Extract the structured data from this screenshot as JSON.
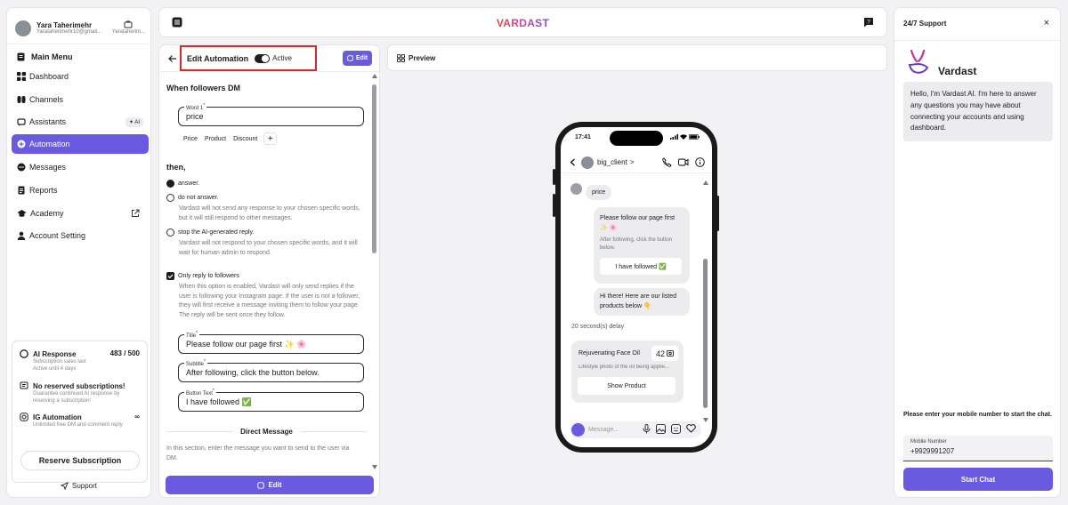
{
  "user": {
    "name": "Yara Taherimehr",
    "email": "Yarataherimehr10@gmail...",
    "short": "Yarataherim..."
  },
  "sidebar": {
    "menu_title": "Main Menu",
    "items": [
      {
        "label": "Dashboard"
      },
      {
        "label": "Channels"
      },
      {
        "label": "Assistants",
        "badge": "AI"
      },
      {
        "label": "Automation"
      },
      {
        "label": "Messages"
      },
      {
        "label": "Reports"
      },
      {
        "label": "Academy"
      },
      {
        "label": "Account Setting"
      }
    ]
  },
  "subscription": {
    "ai_response": {
      "title": "AI Response",
      "count": "483 / 500",
      "desc": "Subscription sales last\nActive until 4 days"
    },
    "reserved": {
      "title": "No reserved subscriptions!",
      "desc": "Guarantee continued AI response by reserving a subscription!"
    },
    "ig": {
      "title": "IG Automation",
      "desc": "Unlimited free DM and comment reply"
    },
    "reserve_button": "Reserve Subscription"
  },
  "support_link": "Support",
  "brand": "VARDAST",
  "editor": {
    "title": "Edit Automation",
    "active_label": "Active",
    "edit_small": "Edit",
    "when_label": "When followers DM",
    "word_label": "Word 1",
    "word_value": "price",
    "chips": [
      "Price",
      "Product",
      "Discount"
    ],
    "chip_add": "+",
    "then_label": "then,",
    "options": [
      {
        "label": "answer."
      },
      {
        "label": "do not answer.",
        "desc": "Vardast will not send any response to your chosen specific words, but it will still respond to other messages."
      },
      {
        "label": "stop the AI-generated reply.",
        "desc": "Vardast will not respond to your chosen specific words, and it will wait for human admin to respond."
      }
    ],
    "followers_only": {
      "label": "Only reply to followers",
      "desc": "When this option is enabled, Vardast will only send replies if the user is following your Instagram page. If the user is not a follower, they will first receive a message inviting them to follow your page. The reply will be sent once they follow."
    },
    "title_field": {
      "label": "Title",
      "value": "Please follow our page first ✨ 🌸"
    },
    "subtitle_field": {
      "label": "Subtitle",
      "value": "After following, click the button below."
    },
    "button_field": {
      "label": "Button Text",
      "value": "I have followed ✅"
    },
    "direct_message": "Direct Message",
    "dm_desc": "In this section, enter the message you want to send to the user via DM.",
    "edit_big": "Edit"
  },
  "preview": {
    "label": "Preview",
    "time": "17:41",
    "username": "big_client",
    "chevron": ">",
    "user_msg": "price",
    "card1": {
      "title": "Please follow our page first ✨ 🌸",
      "subtitle": "After following, click the button below.",
      "button": "I have followed ✅"
    },
    "msg2": "Hi there! Here are our listed products below 👇",
    "delay": "20 second(s) delay",
    "product": {
      "name": "Rejuvenating Face Oil",
      "count": "42",
      "desc": "Lifestyle photo of the oil being applie...",
      "button": "Show Product"
    },
    "input_placeholder": "Message..."
  },
  "support": {
    "title": "24/7 Support",
    "close": "×",
    "bot_name": "Vardast",
    "intro": "Hello, I'm Vardast AI. I'm here to answer any questions you may have about connecting your accounts and using dashboard.",
    "hint": "Please enter your mobile number to start the chat.",
    "field_label": "Mobile Number",
    "field_value": "+9929991207",
    "start_button": "Start Chat"
  },
  "colors": {
    "accent": "#6a5ae0",
    "highlight": "#d22a2a"
  }
}
